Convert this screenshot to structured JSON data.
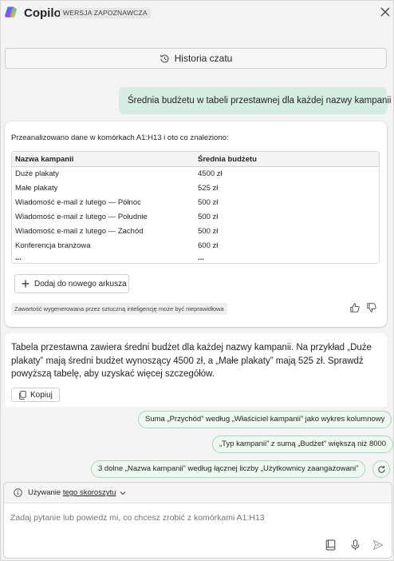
{
  "header": {
    "title": "Copilot",
    "badge": "WERSJA ZAPOZNAWCZA"
  },
  "history_button": {
    "label": "Historia czatu"
  },
  "user_message": "Średnia budżetu w tabeli przestawnej dla każdej nazwy kampanii",
  "response": {
    "intro": "Przeanalizowano dane w komórkach A1:H13 i oto co znaleziono:",
    "table": {
      "headers": [
        "Nazwa kampanii",
        "Średnia budżetu"
      ],
      "rows": [
        [
          "Duże plakaty",
          "4500 zł"
        ],
        [
          "Małe plakaty",
          "525 zł"
        ],
        [
          "Wiadomość e-mail z lutego — Północ",
          "500 zł"
        ],
        [
          "Wiadomość e-mail z lutego — Południe",
          "500 zł"
        ],
        [
          "Wiadomość e-mail z lutego — Zachód",
          "500 zł"
        ],
        [
          "Konferencja branżowa",
          "600 zł"
        ],
        [
          "...",
          "..."
        ]
      ]
    },
    "add_sheet_label": "Dodaj do nowego arkusza",
    "disclaimer": "Zawartość wygenerowana przez sztuczną inteligencję może być nieprawidłowa"
  },
  "summary": {
    "text": "Tabela przestawna zawiera średni budżet dla każdej nazwy kampanii. Na przykład „Duże plakaty” mają średni budżet wynoszący 4500 zł, a „Małe plakaty” mają 525 zł. Sprawdź powyższą tabelę, aby uzyskać więcej szczegółów.",
    "copy_label": "Kopiuj"
  },
  "suggestions": [
    "Suma „Przychód” według „Właściciel kampanii” jako wykres kolumnowy",
    "„Typ kampanii” z sumą „Budżet” większą niż 8000",
    "3 dolne „Nazwa kampanii” według łącznej liczby „Użytkownicy zaangażowani”"
  ],
  "composer": {
    "usage_prefix": "Używanie ",
    "usage_link": "tego skoroszytu",
    "placeholder": "Zadaj pytanie lub powiedz mi, co chcesz zrobić z komórkami A1:H13"
  },
  "colors": {
    "accent_green": "#d4ece1",
    "chip_border": "#a8d6bd"
  }
}
